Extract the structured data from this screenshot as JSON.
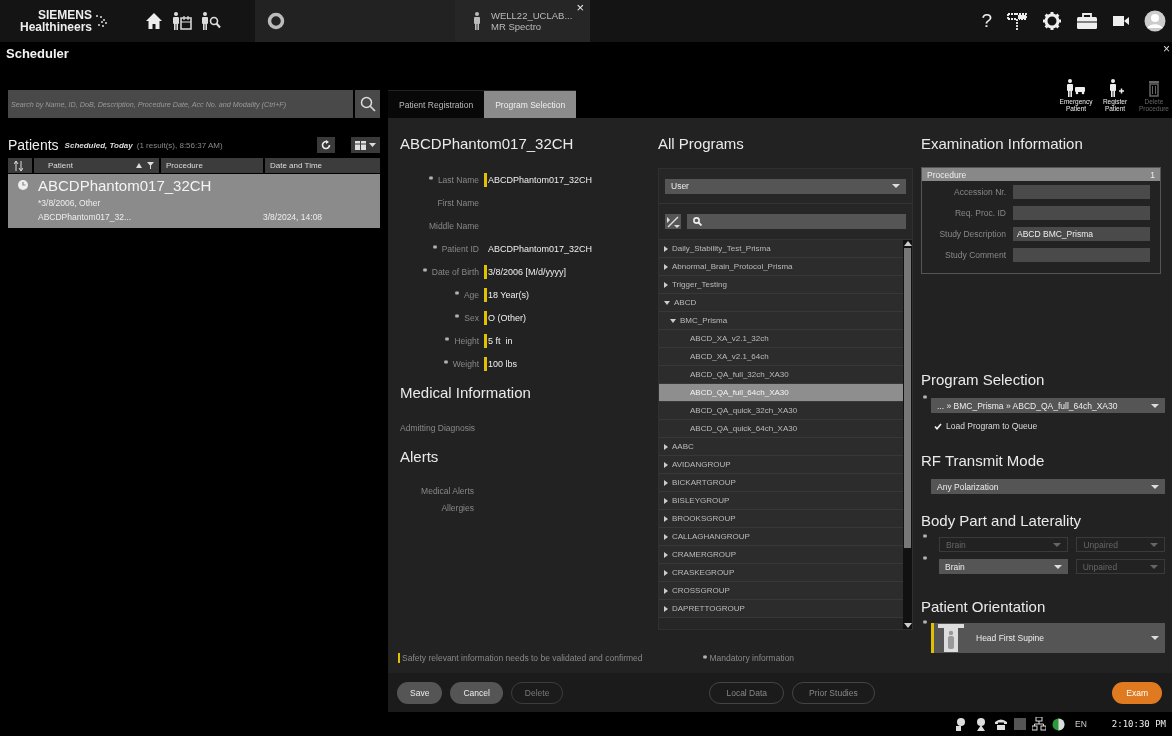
{
  "header": {
    "logo": [
      "SIEMENS",
      "Healthineers"
    ],
    "workspace_tab": {
      "title": "WELL22_UCLAB...",
      "subtitle": "MR Spectro",
      "close": "×"
    },
    "help": "?"
  },
  "scheduler": {
    "title": "Scheduler",
    "close": "×"
  },
  "toolbar": [
    {
      "label": "Emergency Patient",
      "disabled": false
    },
    {
      "label": "Register Patient",
      "disabled": false
    },
    {
      "label": "Delete Procedure",
      "disabled": true
    }
  ],
  "search": {
    "placeholder": "Search by Name, ID, DoB, Description, Procedure Date, Acc No. and Modality (Ctrl+F)"
  },
  "patients": {
    "title": "Patients",
    "filter": "Scheduled, Today",
    "info": "(1 result(s), 8:56:37 AM)",
    "columns": [
      "Patient",
      "Procedure",
      "Date and Time"
    ],
    "rows": [
      {
        "name": "ABCDPhantom017_32CH",
        "details": "*3/8/2006, Other",
        "procedure": "ABCDPhantom017_32...",
        "date_time": "3/8/2024, 14:08",
        "selected": true
      }
    ]
  },
  "tabs": [
    {
      "label": "Patient Registration",
      "selected": false
    },
    {
      "label": "Program Selection",
      "selected": true
    }
  ],
  "registration": {
    "title": "ABCDPhantom017_32CH",
    "fields": [
      {
        "label": "Last Name",
        "value": "ABCDPhantom017_32CH",
        "required": true,
        "safety": true
      },
      {
        "label": "First Name",
        "required": false
      },
      {
        "label": "Middle Name",
        "required": false
      },
      {
        "label": "Patient ID",
        "value": "ABCDPhantom017_32CH",
        "required": true,
        "safety": false
      },
      {
        "label": "Date of Birth",
        "value": "3/8/2006 [M/d/yyyy]",
        "required": true,
        "safety": true
      },
      {
        "label": "Age",
        "value": "18 Year(s)",
        "required": true,
        "safety": true
      },
      {
        "label": "Sex",
        "value": "O (Other)",
        "required": true,
        "safety": true
      },
      {
        "label": "Height",
        "value": "5 ft  in",
        "required": true,
        "safety": true
      },
      {
        "label": "Weight",
        "value": "100 lbs",
        "required": true,
        "safety": true
      }
    ],
    "medical_title": "Medical Information",
    "medical_fields": [
      "Admitting Diagnosis"
    ],
    "alerts_title": "Alerts",
    "alert_fields": [
      "Medical Alerts",
      "Allergies"
    ]
  },
  "programs": {
    "title": "All Programs",
    "source": "User",
    "tree": [
      {
        "label": "Daily_Stability_Test_Prisma",
        "expanded": false,
        "selected": false
      },
      {
        "label": "Abnormal_Brain_Protocol_Prisma",
        "expanded": false,
        "selected": false
      },
      {
        "label": "Trigger_Testing",
        "expanded": false,
        "selected": false
      },
      {
        "label": "ABCD",
        "expanded": true,
        "selected": false,
        "children": [
          {
            "label": "BMC_Prisma",
            "expanded": true,
            "selected": false,
            "children": [
              {
                "label": "ABCD_XA_v2.1_32ch",
                "selected": false
              },
              {
                "label": "ABCD_XA_v2.1_64ch",
                "selected": false
              },
              {
                "label": "ABCD_QA_full_32ch_XA30",
                "selected": false
              },
              {
                "label": "ABCD_QA_full_64ch_XA30",
                "selected": true
              },
              {
                "label": "ABCD_QA_quick_32ch_XA30",
                "selected": false
              },
              {
                "label": "ABCD_QA_quick_64ch_XA30",
                "selected": false
              }
            ]
          }
        ]
      },
      {
        "label": "AABC",
        "expanded": false,
        "selected": false
      },
      {
        "label": "AVIDANGROUP",
        "expanded": false,
        "selected": false
      },
      {
        "label": "BICKARTGROUP",
        "expanded": false,
        "selected": false
      },
      {
        "label": "BISLEYGROUP",
        "expanded": false,
        "selected": false
      },
      {
        "label": "BROOKSGROUP",
        "expanded": false,
        "selected": false
      },
      {
        "label": "CALLAGHANGROUP",
        "expanded": false,
        "selected": false
      },
      {
        "label": "CRAMERGROUP",
        "expanded": false,
        "selected": false
      },
      {
        "label": "CRASKEGROUP",
        "expanded": false,
        "selected": false
      },
      {
        "label": "CROSSGROUP",
        "expanded": false,
        "selected": false
      },
      {
        "label": "DAPRETTOGROUP",
        "expanded": false,
        "selected": false
      }
    ]
  },
  "exam": {
    "title": "Examination Information",
    "procedure": {
      "label": "Procedure",
      "count": "1",
      "fields": [
        {
          "label": "Accession Nr."
        },
        {
          "label": "Req. Proc. ID"
        },
        {
          "label": "Study Description",
          "value": "ABCD BMC_Prisma"
        },
        {
          "label": "Study Comment"
        }
      ]
    },
    "program_title": "Program Selection",
    "program": {
      "value": "... » BMC_Prisma » ABCD_QA_full_64ch_XA30",
      "required": true
    },
    "load_queue": {
      "label": "Load Program to Queue",
      "checked": true
    },
    "rf_title": "RF Transmit Mode",
    "rf": {
      "value": "Any Polarization"
    },
    "body_title": "Body Part and Laterality",
    "body_rows": [
      {
        "part": {
          "value": "Brain",
          "disabled": true
        },
        "laterality": {
          "value": "Unpaired",
          "disabled": true
        }
      },
      {
        "part": {
          "value": "Brain",
          "disabled": false
        },
        "laterality": {
          "value": "Unpaired",
          "disabled": true
        }
      }
    ],
    "orientation_title": "Patient Orientation",
    "orientation": {
      "value": "Head First Supine",
      "required": true,
      "safety": true
    }
  },
  "notes": {
    "safety": "Safety relevant information needs to be validated and confirmed",
    "mandatory": "Mandatory information"
  },
  "buttons": [
    {
      "label": "Save",
      "kind": "default"
    },
    {
      "label": "Cancel",
      "kind": "default"
    },
    {
      "label": "Delete",
      "kind": "disabled"
    },
    {
      "label": "Local Data",
      "kind": "outline"
    },
    {
      "label": "Prior Studies",
      "kind": "outline"
    },
    {
      "label": "Exam",
      "kind": "primary"
    }
  ],
  "status_bar": {
    "language": "EN",
    "time": "2:10:30 PM"
  }
}
